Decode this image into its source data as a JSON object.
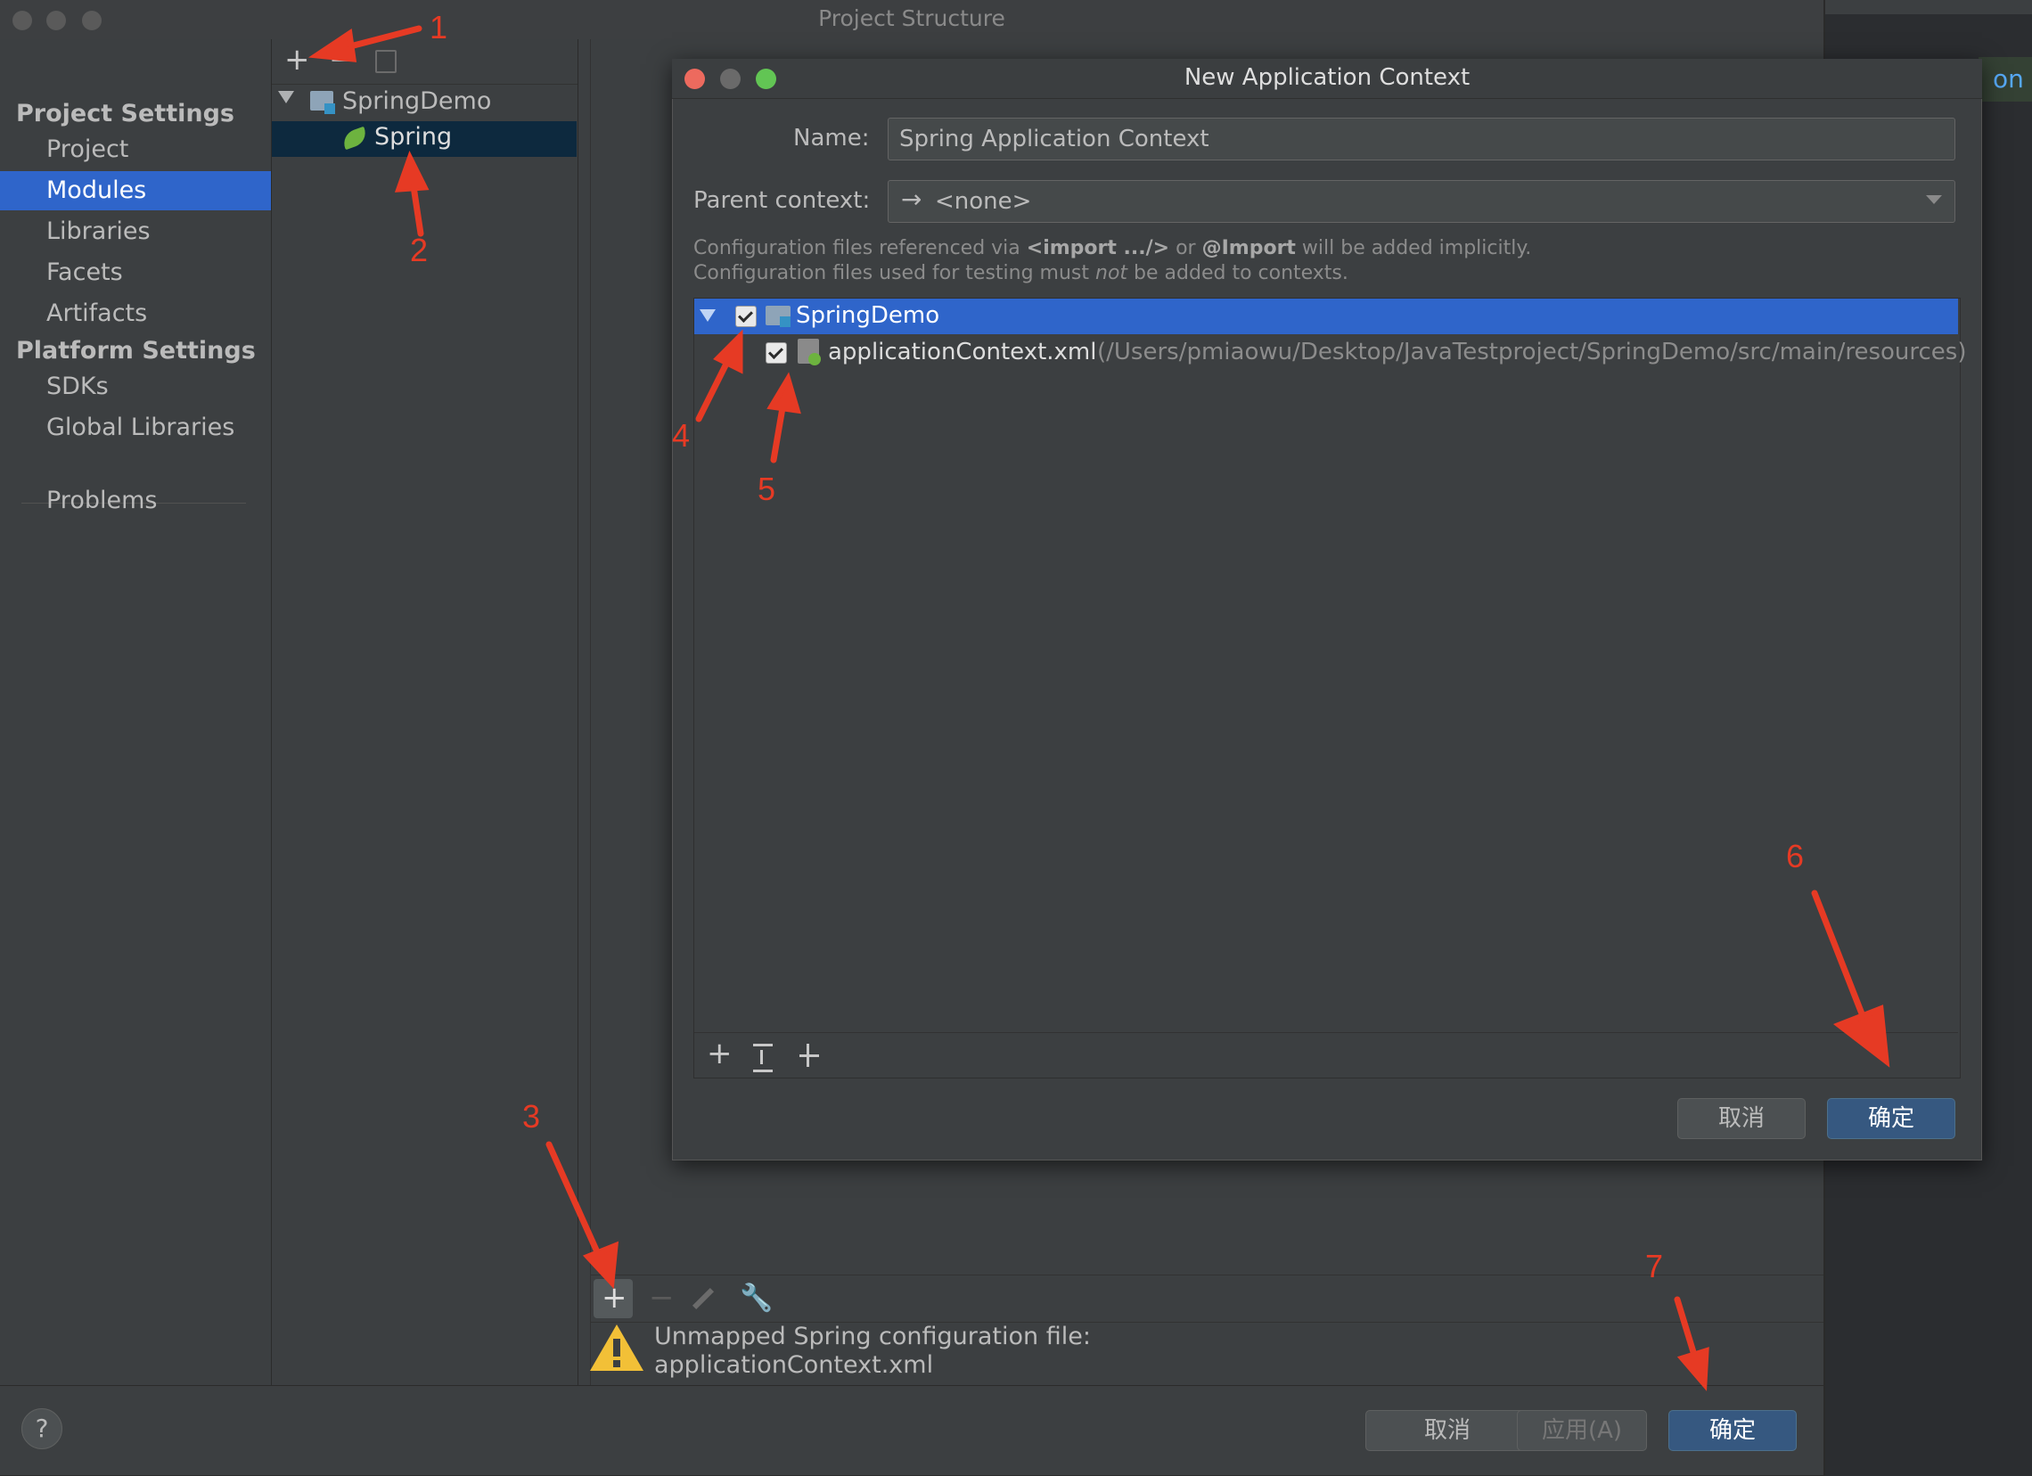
{
  "window": {
    "title": "Project Structure",
    "back_icon": "arrow-left-icon",
    "forward_icon": "arrow-right-icon"
  },
  "background_editor": {
    "peek_text": "on co"
  },
  "sidebar": {
    "project_settings_header": "Project Settings",
    "platform_settings_header": "Platform Settings",
    "items": [
      {
        "label": "Project",
        "selected": false
      },
      {
        "label": "Modules",
        "selected": true
      },
      {
        "label": "Libraries",
        "selected": false
      },
      {
        "label": "Facets",
        "selected": false
      },
      {
        "label": "Artifacts",
        "selected": false
      },
      {
        "label": "SDKs",
        "selected": false
      },
      {
        "label": "Global Libraries",
        "selected": false
      },
      {
        "label": "Problems",
        "selected": false
      }
    ]
  },
  "module_tree": {
    "toolbar": {
      "add": "+",
      "remove": "−"
    },
    "root": "SpringDemo",
    "child": "Spring"
  },
  "facet_panel": {
    "warning_line1": "Unmapped Spring configuration file:",
    "warning_line2": "applicationContext.xml"
  },
  "bottom_buttons": {
    "cancel": "取消",
    "apply": "应用(A)",
    "ok": "确定",
    "help": "?"
  },
  "dialog": {
    "title": "New Application Context",
    "name_label": "Name:",
    "name_value": "Spring Application Context",
    "parent_label": "Parent context:",
    "parent_value": "<none>",
    "hint_line1_a": "Configuration files referenced via ",
    "hint_line1_b": "<import .../>",
    "hint_line1_c": " or ",
    "hint_line1_d": "@Import",
    "hint_line1_e": " will be added implicitly.",
    "hint_line2_a": "Configuration files used for testing must ",
    "hint_line2_b": "not",
    "hint_line2_c": " be added to contexts.",
    "files": {
      "root": "SpringDemo",
      "child_name": "applicationContext.xml",
      "child_path": "(/Users/pmiaowu/Desktop/JavaTestproject/SpringDemo/src/main/resources)"
    },
    "cancel": "取消",
    "ok": "确定"
  },
  "annotations": [
    "1",
    "2",
    "3",
    "4",
    "5",
    "6",
    "7"
  ],
  "colors": {
    "selection": "#2f65ca",
    "primary_button": "#365880",
    "annotation": "#e63a24",
    "warning": "#f2c037"
  }
}
